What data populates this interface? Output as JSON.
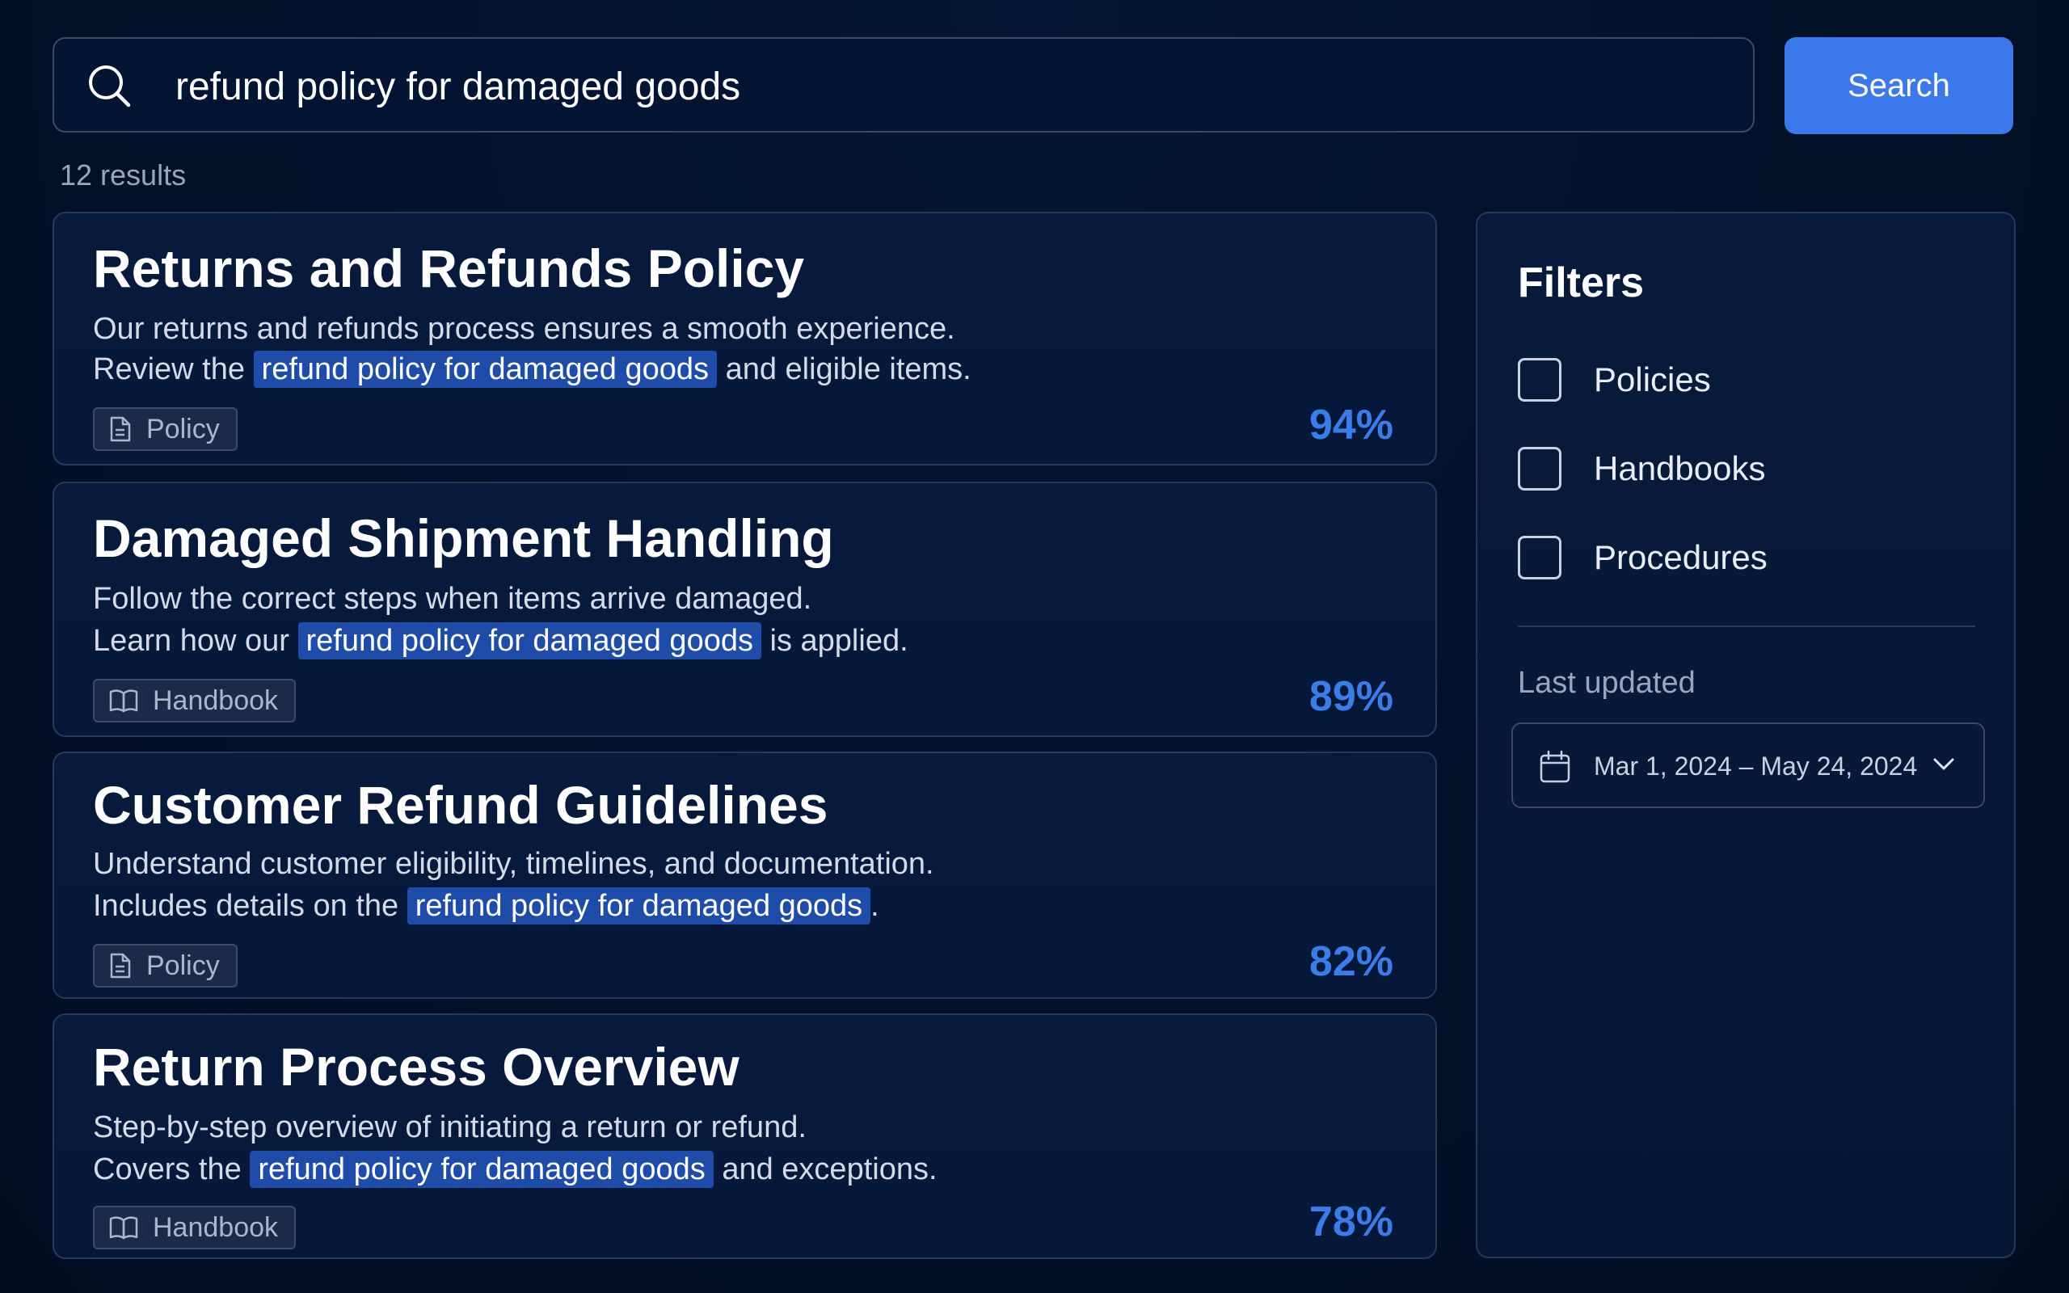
{
  "search": {
    "query": "refund policy for damaged goods",
    "button_label": "Search"
  },
  "result_count": "12 results",
  "results": [
    {
      "title": "Returns and Refunds Policy",
      "line1": "Our returns and refunds process ensures a smooth experience.",
      "line2_before": "Review the ",
      "line2_highlight": "refund policy for damaged goods",
      "line2_after": " and eligible items.",
      "tag": "Policy",
      "tag_icon": "document-icon",
      "score": "94%"
    },
    {
      "title": "Damaged Shipment Handling",
      "line1": "Follow the correct steps when items arrive damaged.",
      "line2_before": "Learn how our ",
      "line2_highlight": "refund policy for damaged goods",
      "line2_after": " is applied.",
      "tag": "Handbook",
      "tag_icon": "book-icon",
      "score": "89%"
    },
    {
      "title": "Customer Refund Guidelines",
      "line1": "Understand customer eligibility, timelines, and documentation.",
      "line2_before": "Includes details on the ",
      "line2_highlight": "refund policy for damaged goods",
      "line2_after": ".",
      "tag": "Policy",
      "tag_icon": "document-icon",
      "score": "82%"
    },
    {
      "title": "Return Process Overview",
      "line1": "Step-by-step overview of initiating a return or refund.",
      "line2_before": "Covers the ",
      "line2_highlight": "refund policy for damaged goods",
      "line2_after": " and exceptions.",
      "tag": "Handbook",
      "tag_icon": "book-icon",
      "score": "78%"
    }
  ],
  "filters": {
    "title": "Filters",
    "options": [
      {
        "label": "Policies",
        "checked": false
      },
      {
        "label": "Handbooks",
        "checked": false
      },
      {
        "label": "Procedures",
        "checked": false
      }
    ],
    "last_updated_label": "Last updated",
    "date_range": "Mar 1, 2024 – May 24, 2024"
  },
  "colors": {
    "background": "#02112a",
    "accent": "#3b78ea",
    "highlight": "#1e4ca8",
    "score": "#3b7de8"
  }
}
